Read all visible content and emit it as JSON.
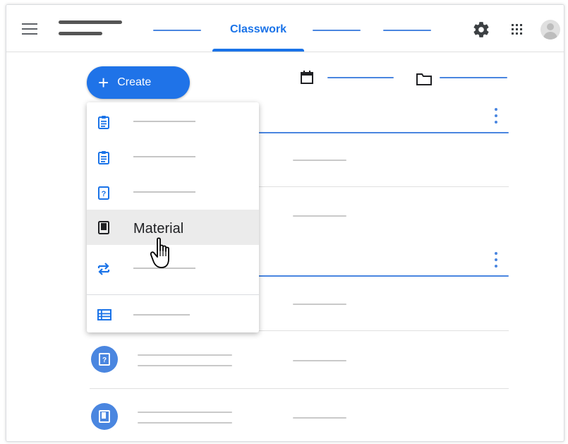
{
  "header": {
    "active_tab_label": "Classwork",
    "icons": [
      "menu-icon",
      "settings-icon",
      "apps-icon",
      "account-icon"
    ]
  },
  "toolbar": {
    "create_label": "Create",
    "create_icon": "plus-icon",
    "filter_icons": [
      "calendar-icon",
      "folder-icon"
    ]
  },
  "create_menu": {
    "items": [
      {
        "icon": "assignment-icon",
        "label": "",
        "highlighted": false
      },
      {
        "icon": "quiz-assignment-icon",
        "label": "",
        "highlighted": false
      },
      {
        "icon": "question-icon",
        "label": "",
        "highlighted": false
      },
      {
        "icon": "material-icon",
        "label": "Material",
        "highlighted": true
      },
      {
        "icon": "reuse-post-icon",
        "label": "",
        "highlighted": false
      },
      {
        "icon": "topic-icon",
        "label": "",
        "highlighted": false
      }
    ]
  },
  "list": {
    "rows": [
      {
        "icon": "question-icon"
      },
      {
        "icon": "material-icon"
      }
    ]
  },
  "colors": {
    "accent": "#1a73e8",
    "accent_light": "#4a86e0",
    "placeholder_gray": "#c9c9c9",
    "hover_gray": "#ebebeb"
  }
}
